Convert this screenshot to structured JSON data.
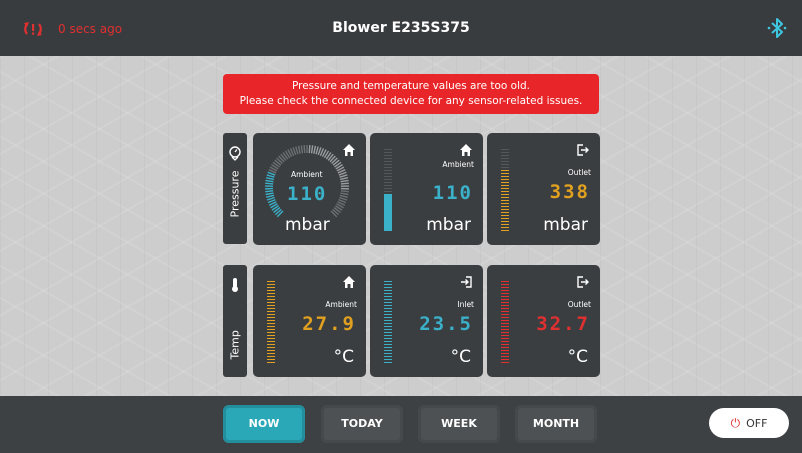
{
  "header": {
    "sync_status": "0 secs ago",
    "title": "Blower E235S375",
    "icons": [
      "sync-alert-icon",
      "bluetooth-icon"
    ]
  },
  "alert": {
    "line1": "Pressure and temperature values are too old.",
    "line2": "Please check the connected device for any sensor-related issues.",
    "color": "#e8262a"
  },
  "pressure": {
    "section_label": "Pressure",
    "section_icon": "pressure-gauge-icon",
    "cards": [
      {
        "label": "Ambient",
        "value": "110",
        "unit": "mbar",
        "icon": "home-icon",
        "color": "#3bb0c9",
        "level": 0.55
      },
      {
        "label": "Ambient",
        "value": "110",
        "unit": "mbar",
        "icon": "home-icon",
        "color": "#3bb0c9",
        "level": 0.45
      },
      {
        "label": "Outlet",
        "value": "338",
        "unit": "mbar",
        "icon": "outlet-icon",
        "color": "#e0a020",
        "level": 0.75
      }
    ]
  },
  "temperature": {
    "section_label": "Temp",
    "section_icon": "thermometer-icon",
    "cards": [
      {
        "label": "Ambient",
        "value": "27.9",
        "unit": "°C",
        "icon": "home-icon",
        "color": "#e0a020",
        "level": 1.0
      },
      {
        "label": "Inlet",
        "value": "23.5",
        "unit": "°C",
        "icon": "inlet-icon",
        "color": "#3bb0c9",
        "level": 1.0
      },
      {
        "label": "Outlet",
        "value": "32.7",
        "unit": "°C",
        "icon": "outlet-icon",
        "color": "#e03030",
        "level": 1.0
      }
    ]
  },
  "footer": {
    "tabs": [
      "NOW",
      "TODAY",
      "WEEK",
      "MONTH"
    ],
    "active_tab": "NOW",
    "power_label": "OFF",
    "accent": "#2aa8b8"
  }
}
